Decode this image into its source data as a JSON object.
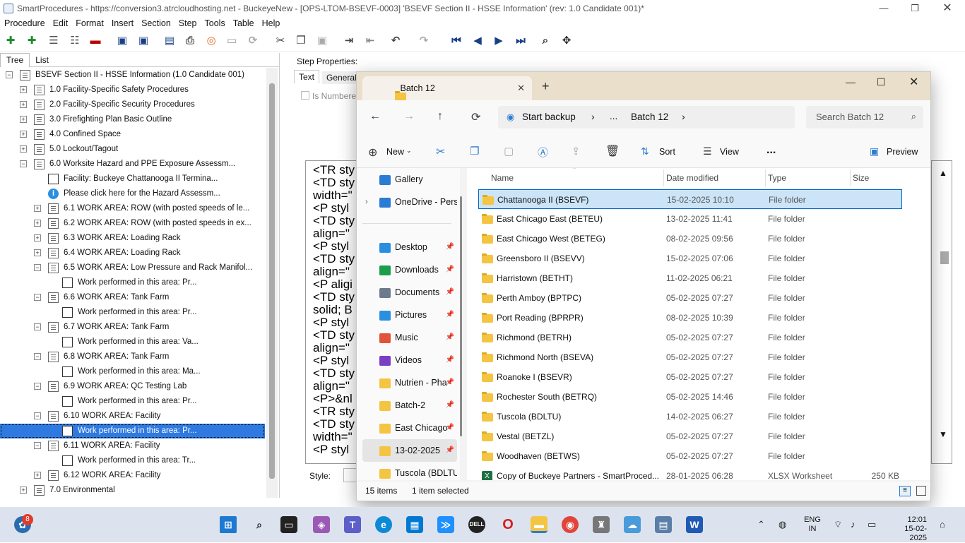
{
  "window": {
    "title": "SmartProcedures - https://conversion3.atrcloudhosting.net - BuckeyeNew - [OPS-LTOM-BSEVF-0003] 'BSEVF Section II - HSSE Information' (rev: 1.0 Candidate 001)*"
  },
  "menu": [
    "Procedure",
    "Edit",
    "Format",
    "Insert",
    "Section",
    "Step",
    "Tools",
    "Table",
    "Help"
  ],
  "left_tabs": [
    "Tree",
    "List"
  ],
  "tree": [
    {
      "lvl": 0,
      "pm": "-",
      "icon": "doc",
      "text": "BSEVF Section II - HSSE Information (1.0 Candidate 001)"
    },
    {
      "lvl": 1,
      "pm": "+",
      "icon": "doc",
      "text": "1.0 Facility-Specific Safety Procedures"
    },
    {
      "lvl": 1,
      "pm": "+",
      "icon": "doc",
      "text": "2.0 Facility-Specific Security Procedures"
    },
    {
      "lvl": 1,
      "pm": "+",
      "icon": "doc",
      "text": "3.0 Firefighting Plan Basic Outline"
    },
    {
      "lvl": 1,
      "pm": "+",
      "icon": "doc",
      "text": "4.0 Confined Space"
    },
    {
      "lvl": 1,
      "pm": "+",
      "icon": "doc",
      "text": "5.0 Lockout/Tagout"
    },
    {
      "lvl": 1,
      "pm": "-",
      "icon": "doc",
      "text": "6.0 Worksite Hazard and PPE Exposure Assessm..."
    },
    {
      "lvl": 2,
      "pm": "",
      "icon": "step",
      "text": "Facility: Buckeye Chattanooga II Termina..."
    },
    {
      "lvl": 2,
      "pm": "",
      "icon": "info",
      "text": "Please click here for the Hazard Assessm..."
    },
    {
      "lvl": 2,
      "pm": "+",
      "icon": "doc",
      "text": "6.1 WORK AREA: ROW (with posted speeds of le..."
    },
    {
      "lvl": 2,
      "pm": "+",
      "icon": "doc",
      "text": "6.2 WORK AREA: ROW (with posted speeds in ex..."
    },
    {
      "lvl": 2,
      "pm": "+",
      "icon": "doc",
      "text": "6.3 WORK AREA: Loading Rack"
    },
    {
      "lvl": 2,
      "pm": "+",
      "icon": "doc",
      "text": "6.4 WORK AREA: Loading Rack"
    },
    {
      "lvl": 2,
      "pm": "-",
      "icon": "doc",
      "text": "6.5 WORK AREA: Low Pressure and Rack Manifol..."
    },
    {
      "lvl": 3,
      "pm": "",
      "icon": "step",
      "text": "Work performed in this area:         Pr..."
    },
    {
      "lvl": 2,
      "pm": "-",
      "icon": "doc",
      "text": "6.6 WORK AREA: Tank Farm"
    },
    {
      "lvl": 3,
      "pm": "",
      "icon": "step",
      "text": "Work performed in this area:         Pr..."
    },
    {
      "lvl": 2,
      "pm": "-",
      "icon": "doc",
      "text": "6.7 WORK AREA: Tank Farm"
    },
    {
      "lvl": 3,
      "pm": "",
      "icon": "step",
      "text": "Work performed in this area:         Va..."
    },
    {
      "lvl": 2,
      "pm": "-",
      "icon": "doc",
      "text": "6.8 WORK AREA: Tank Farm"
    },
    {
      "lvl": 3,
      "pm": "",
      "icon": "step",
      "text": "Work performed in this area:         Ma..."
    },
    {
      "lvl": 2,
      "pm": "-",
      "icon": "doc",
      "text": "6.9 WORK AREA: QC Testing Lab"
    },
    {
      "lvl": 3,
      "pm": "",
      "icon": "step",
      "text": "Work performed in this area:         Pr..."
    },
    {
      "lvl": 2,
      "pm": "-",
      "icon": "doc",
      "text": "6.10 WORK AREA: Facility"
    },
    {
      "lvl": 3,
      "pm": "",
      "icon": "step",
      "text": "Work performed in this area:         Pr...",
      "sel": true
    },
    {
      "lvl": 2,
      "pm": "-",
      "icon": "doc",
      "text": "6.11 WORK AREA: Facility"
    },
    {
      "lvl": 3,
      "pm": "",
      "icon": "step",
      "text": "Work performed in this area:         Tr..."
    },
    {
      "lvl": 2,
      "pm": "+",
      "icon": "doc",
      "text": "6.12 WORK AREA: Facility"
    },
    {
      "lvl": 1,
      "pm": "+",
      "icon": "doc",
      "text": "7.0 Environmental"
    }
  ],
  "step_props": {
    "label": "Step Properties:",
    "tab_text": "Text",
    "tab_general": "General",
    "is_numbered": "Is Numbered",
    "style_label": "Style:"
  },
  "editor_lines": [
    "<TR sty",
    "<TD sty",
    "width=\"",
    "<P styl",
    "<TD sty",
    "align=\"",
    "<P styl",
    "<TD sty",
    "align=\"",
    "<P aligi",
    "<TD sty",
    "solid; B",
    "<P styl",
    "<TD sty",
    "align=\"",
    "<P styl",
    "<TD sty",
    "align=\"",
    "<P>&nl",
    "<TR sty",
    "<TD sty",
    "width=\"",
    "<P styl"
  ],
  "explorer": {
    "tab_title": "Batch 12",
    "breadcrumb": [
      "Start backup",
      "...",
      "Batch 12"
    ],
    "search_placeholder": "Search Batch 12",
    "cmd": {
      "new": "New",
      "sort": "Sort",
      "view": "View",
      "more": "...",
      "preview": "Preview"
    },
    "nav": [
      {
        "label": "Gallery",
        "icon": "gallery",
        "pin": false,
        "color": "#2b7cd3"
      },
      {
        "label": "OneDrive - Perso",
        "icon": "cloud",
        "pin": false,
        "color": "#2b7cd3",
        "expander": true
      },
      {
        "label": "Desktop",
        "icon": "desktop",
        "pin": true,
        "color": "#2b8fe0"
      },
      {
        "label": "Downloads",
        "icon": "download",
        "pin": true,
        "color": "#1b9e4b"
      },
      {
        "label": "Documents",
        "icon": "documents",
        "pin": true,
        "color": "#6c7a8c"
      },
      {
        "label": "Pictures",
        "icon": "pictures",
        "pin": true,
        "color": "#2b8fe0"
      },
      {
        "label": "Music",
        "icon": "music",
        "pin": true,
        "color": "#e0533a"
      },
      {
        "label": "Videos",
        "icon": "videos",
        "pin": true,
        "color": "#7b3fc4"
      },
      {
        "label": "Nutrien - Pha",
        "icon": "folder",
        "pin": true,
        "color": "#f4c542"
      },
      {
        "label": "Batch-2",
        "icon": "folder",
        "pin": true,
        "color": "#f4c542"
      },
      {
        "label": "East Chicago",
        "icon": "folder",
        "pin": true,
        "color": "#f4c542"
      },
      {
        "label": "13-02-2025",
        "icon": "folder",
        "pin": true,
        "color": "#f4c542",
        "sel": true
      },
      {
        "label": "Tuscola (BDLTU",
        "icon": "folder",
        "pin": false,
        "color": "#f4c542"
      }
    ],
    "columns": {
      "name": "Name",
      "date": "Date modified",
      "type": "Type",
      "size": "Size"
    },
    "files": [
      {
        "name": "Chattanooga II (BSEVF)",
        "date": "15-02-2025 10:10",
        "type": "File folder",
        "size": "",
        "icon": "folder",
        "sel": true
      },
      {
        "name": "East Chicago East (BETEU)",
        "date": "13-02-2025 11:41",
        "type": "File folder",
        "size": "",
        "icon": "folder"
      },
      {
        "name": "East Chicago West (BETEG)",
        "date": "08-02-2025 09:56",
        "type": "File folder",
        "size": "",
        "icon": "folder"
      },
      {
        "name": "Greensboro II (BSEVV)",
        "date": "15-02-2025 07:06",
        "type": "File folder",
        "size": "",
        "icon": "folder"
      },
      {
        "name": "Harristown (BETHT)",
        "date": "11-02-2025 06:21",
        "type": "File folder",
        "size": "",
        "icon": "folder"
      },
      {
        "name": "Perth Amboy (BPTPC)",
        "date": "05-02-2025 07:27",
        "type": "File folder",
        "size": "",
        "icon": "folder"
      },
      {
        "name": "Port Reading (BPRPR)",
        "date": "08-02-2025 10:39",
        "type": "File folder",
        "size": "",
        "icon": "folder"
      },
      {
        "name": "Richmond (BETRH)",
        "date": "05-02-2025 07:27",
        "type": "File folder",
        "size": "",
        "icon": "folder"
      },
      {
        "name": "Richmond North (BSEVA)",
        "date": "05-02-2025 07:27",
        "type": "File folder",
        "size": "",
        "icon": "folder"
      },
      {
        "name": "Roanoke I (BSEVR)",
        "date": "05-02-2025 07:27",
        "type": "File folder",
        "size": "",
        "icon": "folder"
      },
      {
        "name": "Rochester South (BETRQ)",
        "date": "05-02-2025 14:46",
        "type": "File folder",
        "size": "",
        "icon": "folder"
      },
      {
        "name": "Tuscola (BDLTU)",
        "date": "14-02-2025 06:27",
        "type": "File folder",
        "size": "",
        "icon": "folder"
      },
      {
        "name": "Vestal (BETZL)",
        "date": "05-02-2025 07:27",
        "type": "File folder",
        "size": "",
        "icon": "folder"
      },
      {
        "name": "Woodhaven (BETWS)",
        "date": "05-02-2025 07:27",
        "type": "File folder",
        "size": "",
        "icon": "folder"
      },
      {
        "name": "Copy of Buckeye Partners - SmartProced...",
        "date": "28-01-2025 06:28",
        "type": "XLSX Worksheet",
        "size": "250 KB",
        "icon": "xlsx"
      }
    ],
    "status": {
      "count": "15 items",
      "selected": "1 item selected"
    }
  },
  "taskbar": {
    "badge": "8",
    "lang_top": "ENG",
    "lang_bottom": "IN",
    "time": "12:01",
    "date": "15-02-2025"
  }
}
